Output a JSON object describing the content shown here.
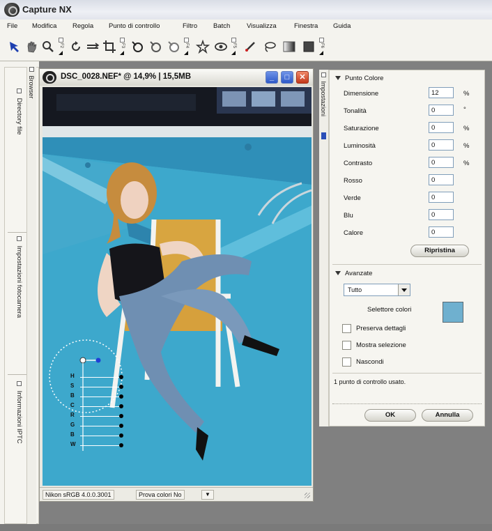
{
  "app": {
    "title": "Capture NX"
  },
  "menu": [
    "File",
    "Modifica",
    "Regola",
    "Punto di controllo",
    "Filtro",
    "Batch",
    "Visualizza",
    "Finestra",
    "Guida"
  ],
  "toolbar": {
    "tools": [
      "arrow-select-icon",
      "hand-icon",
      "zoom-icon",
      "rotate-icon",
      "straighten-icon",
      "crop-icon",
      "black-control-point-icon",
      "neutral-control-point-icon",
      "white-control-point-icon",
      "red-eye-icon",
      "color-control-point-icon",
      "brush-icon",
      "lasso-icon",
      "gradient-icon",
      "fill-icon"
    ],
    "grip_labels": [
      "F2",
      "F3",
      "F4",
      "F5",
      "F6"
    ]
  },
  "left_dock": {
    "tabs": [
      "Directory file",
      "Impostazioni fotocamera",
      "Informazioni IPTC"
    ],
    "browser_label": "Browser"
  },
  "document": {
    "title": "DSC_0028.NEF* @ 14,9% | 15,5MB",
    "status": {
      "profile": "Nikon sRGB 4.0.0.3001",
      "proof": "Prova colori No"
    },
    "control_point_sliders": [
      "H",
      "S",
      "B",
      "C",
      "R",
      "G",
      "B",
      "W"
    ]
  },
  "settings": {
    "tab_label": "Impostazioni",
    "section_title": "Punto Colore",
    "rows": [
      {
        "label": "Dimensione",
        "value": "12",
        "unit": "%"
      },
      {
        "label": "Tonalità",
        "value": "0",
        "unit": "°"
      },
      {
        "label": "Saturazione",
        "value": "0",
        "unit": "%"
      },
      {
        "label": "Luminosità",
        "value": "0",
        "unit": "%"
      },
      {
        "label": "Contrasto",
        "value": "0",
        "unit": "%"
      },
      {
        "label": "Rosso",
        "value": "0",
        "unit": ""
      },
      {
        "label": "Verde",
        "value": "0",
        "unit": ""
      },
      {
        "label": "Blu",
        "value": "0",
        "unit": ""
      },
      {
        "label": "Calore",
        "value": "0",
        "unit": ""
      }
    ],
    "reset_label": "Ripristina",
    "advanced_title": "Avanzate",
    "mode_value": "Tutto",
    "color_picker_label": "Selettore colori",
    "swatch_color": "#6fb0cf",
    "options": [
      {
        "label": "Preserva dettagli",
        "checked": false
      },
      {
        "label": "Mostra selezione",
        "checked": false
      },
      {
        "label": "Nascondi",
        "checked": false
      }
    ],
    "status_text": "1 punto di controllo usato.",
    "ok_label": "OK",
    "cancel_label": "Annulla"
  },
  "colors": {
    "pool_blue": "#49b2d1",
    "selection_blue": "#2b4fb8",
    "close_red": "#c3381a"
  }
}
